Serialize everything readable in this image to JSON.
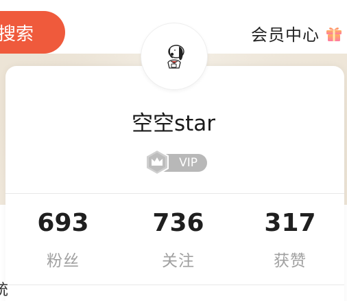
{
  "header": {
    "search_label": "搜索",
    "member_center_label": "会员中心",
    "gift_icon": "gift-icon"
  },
  "profile": {
    "avatar_icon": "snoopy-avatar",
    "username": "空空star",
    "vip_label": "VIP",
    "vip_badge_color": "#b8b8b8"
  },
  "stats": [
    {
      "value": "693",
      "label": "粉丝"
    },
    {
      "value": "736",
      "label": "关注"
    },
    {
      "value": "317",
      "label": "获赞"
    }
  ],
  "edge_text": {
    "left_cut_char": "统"
  },
  "colors": {
    "accent": "#ef5a3c",
    "text_primary": "#1f1f1f",
    "text_secondary": "#a0a0a0"
  }
}
